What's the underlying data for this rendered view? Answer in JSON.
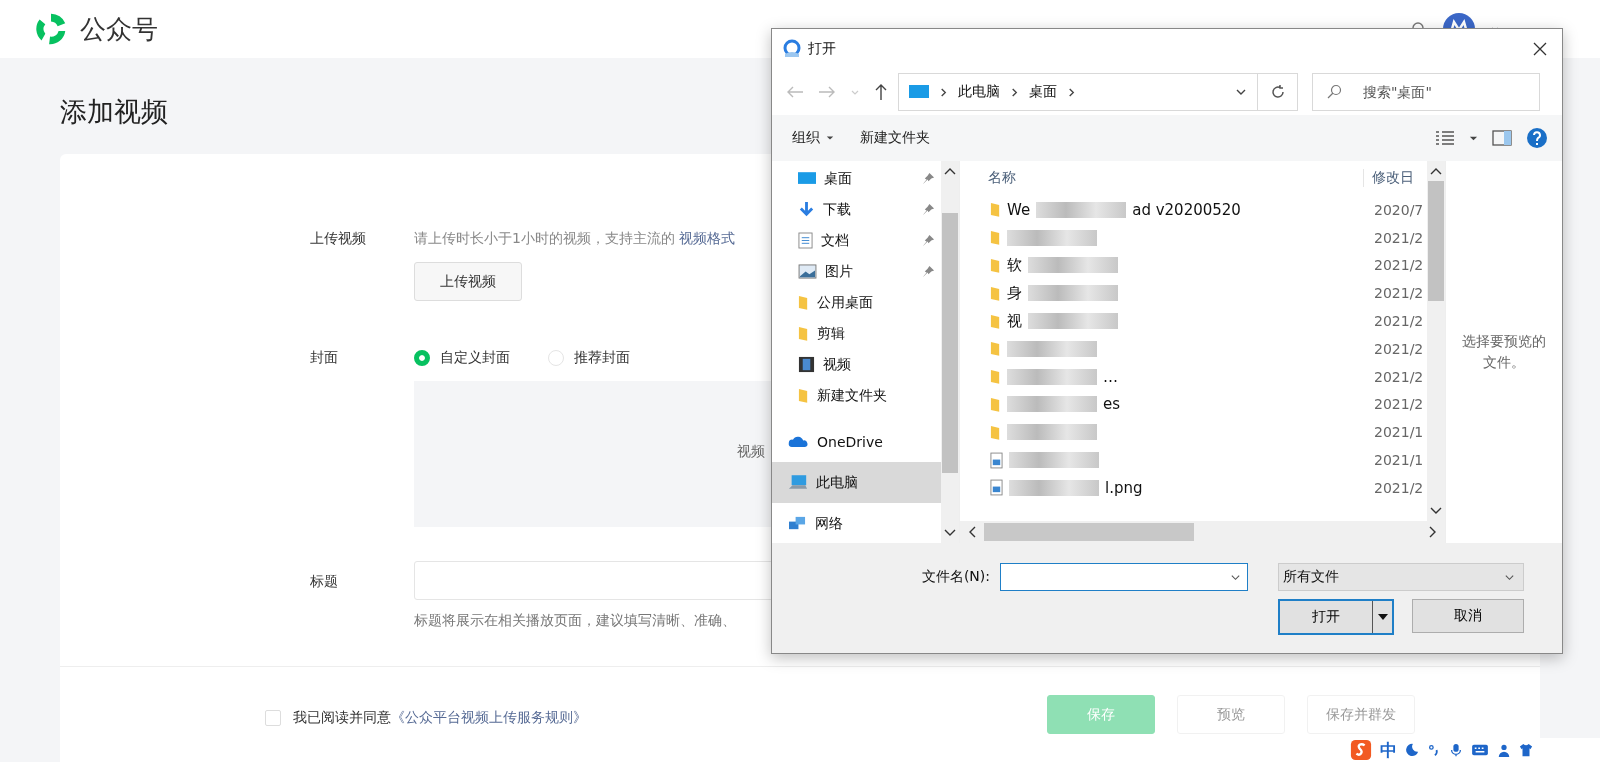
{
  "header": {
    "brand": "公众号"
  },
  "page": {
    "title": "添加视频"
  },
  "form": {
    "upload": {
      "label": "上传视频",
      "hint": "请上传时长小于1小时的视频，支持主流的 ",
      "hint_link": "视频格式",
      "button": "上传视频"
    },
    "cover": {
      "label": "封面",
      "options": [
        {
          "label": "自定义封面",
          "selected": true
        },
        {
          "label": "推荐封面",
          "selected": false
        }
      ],
      "area_text": "视频"
    },
    "title": {
      "label": "标题",
      "hint": "标题将展示在相关播放页面，建议填写清晰、准确、"
    }
  },
  "footer": {
    "agree_checked": false,
    "agree_text": "我已阅读并同意",
    "agree_link": "《公众平台视频上传服务规则》",
    "buttons": [
      {
        "label": "保存",
        "kind": "primary",
        "disabled": true
      },
      {
        "label": "预览",
        "kind": "default",
        "disabled": true
      },
      {
        "label": "保存并群发",
        "kind": "default",
        "disabled": true
      }
    ]
  },
  "ime": {
    "label": "中"
  },
  "dialog": {
    "title": "打开",
    "breadcrumb": [
      "此电脑",
      "桌面"
    ],
    "search": {
      "placeholder": "搜索\"桌面\""
    },
    "toolbar": {
      "organize": "组织",
      "new_folder": "新建文件夹"
    },
    "quick_access": [
      {
        "label": "桌面",
        "kind": "desktop",
        "pinned": true
      },
      {
        "label": "下载",
        "kind": "download",
        "pinned": true
      },
      {
        "label": "文档",
        "kind": "document",
        "pinned": true
      },
      {
        "label": "图片",
        "kind": "image",
        "pinned": true
      },
      {
        "label": "公用桌面",
        "kind": "folder",
        "pinned": false
      },
      {
        "label": "剪辑",
        "kind": "folder",
        "pinned": false
      },
      {
        "label": "视频",
        "kind": "video",
        "pinned": false
      },
      {
        "label": "新建文件夹",
        "kind": "folder",
        "pinned": false
      }
    ],
    "locations": [
      {
        "label": "OneDrive",
        "kind": "cloud",
        "selected": false
      },
      {
        "label": "此电脑",
        "kind": "computer",
        "selected": true
      },
      {
        "label": "网络",
        "kind": "network",
        "selected": false
      }
    ],
    "columns": [
      "名称",
      "修改日"
    ],
    "files": [
      {
        "kind": "folder",
        "prefix": "We",
        "suffix": "ad v20200520",
        "date": "2020/7"
      },
      {
        "kind": "folder",
        "date": "2021/2"
      },
      {
        "kind": "folder",
        "prefix": "软",
        "date": "2021/2"
      },
      {
        "kind": "folder",
        "prefix": "身",
        "date": "2021/2"
      },
      {
        "kind": "folder",
        "prefix": "视",
        "date": "2021/2"
      },
      {
        "kind": "folder",
        "date": "2021/2"
      },
      {
        "kind": "folder",
        "suffix": "…",
        "date": "2021/2"
      },
      {
        "kind": "folder",
        "suffix": "es",
        "date": "2021/2"
      },
      {
        "kind": "folder",
        "date": "2021/1"
      },
      {
        "kind": "image",
        "date": "2021/1"
      },
      {
        "kind": "image",
        "suffix": "l.png",
        "date": "2021/2"
      }
    ],
    "preview_text": "选择要预览的文件。",
    "filename_label": "文件名(N):",
    "filetype": "所有文件",
    "open_button": "打开",
    "cancel_button": "取消"
  }
}
